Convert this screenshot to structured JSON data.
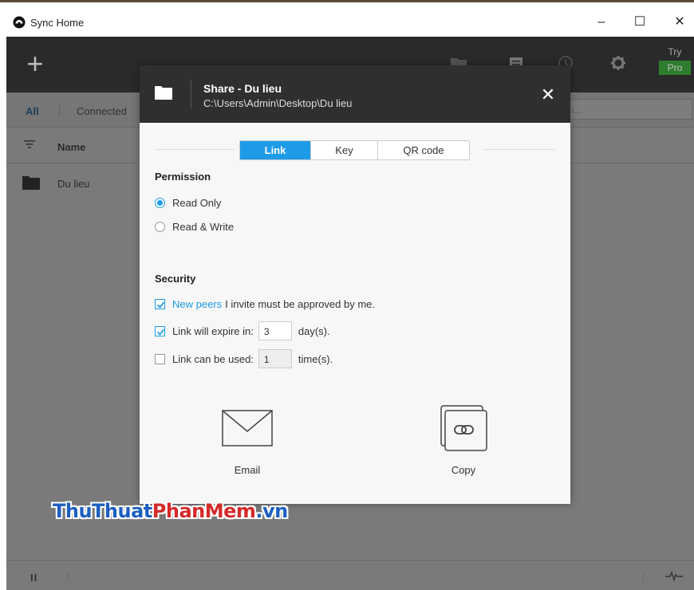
{
  "window": {
    "title": "Sync Home",
    "minimize_glyph": "–",
    "maximize_glyph": "☐",
    "close_glyph": "✕"
  },
  "toolbar": {
    "add_glyph": "+",
    "icons": [
      "folder-icon",
      "list-icon",
      "history-icon",
      "settings-icon"
    ],
    "try_label": "Try",
    "pro_label": "Pro"
  },
  "filters": {
    "all_label": "All",
    "connected_label": "Connected",
    "search_placeholder": "th..."
  },
  "table": {
    "name_header": "Name",
    "rows": [
      {
        "name": "Du lieu"
      }
    ]
  },
  "statusbar": {
    "pause_glyph": "II"
  },
  "dialog": {
    "title": "Share - Du lieu",
    "path": "C:\\Users\\Admin\\Desktop\\Du lieu",
    "close_glyph": "✕",
    "tabs": [
      {
        "label": "Link",
        "active": true
      },
      {
        "label": "Key",
        "active": false
      },
      {
        "label": "QR code",
        "active": false
      }
    ],
    "permission": {
      "title": "Permission",
      "options": [
        {
          "label": "Read Only",
          "selected": true
        },
        {
          "label": "Read & Write",
          "selected": false
        }
      ]
    },
    "security": {
      "title": "Security",
      "approve": {
        "checked": true,
        "link_text": "New peers",
        "rest_text": "I invite must be approved by me."
      },
      "expire": {
        "checked": true,
        "label": "Link will expire in:",
        "value": "3",
        "unit": "day(s)."
      },
      "uses": {
        "checked": false,
        "label": "Link can be used:",
        "value": "1",
        "unit": "time(s)."
      }
    },
    "share_options": [
      {
        "label": "Email",
        "icon": "email-icon"
      },
      {
        "label": "Copy",
        "icon": "copy-link-icon"
      }
    ]
  },
  "watermark": {
    "part1": "ThuThuat",
    "part2": "PhanMem",
    "part3": ".vn"
  },
  "colors": {
    "accent": "#1e9be8",
    "toolbar": "#2a2a2a",
    "pro": "#2e7d2e"
  }
}
